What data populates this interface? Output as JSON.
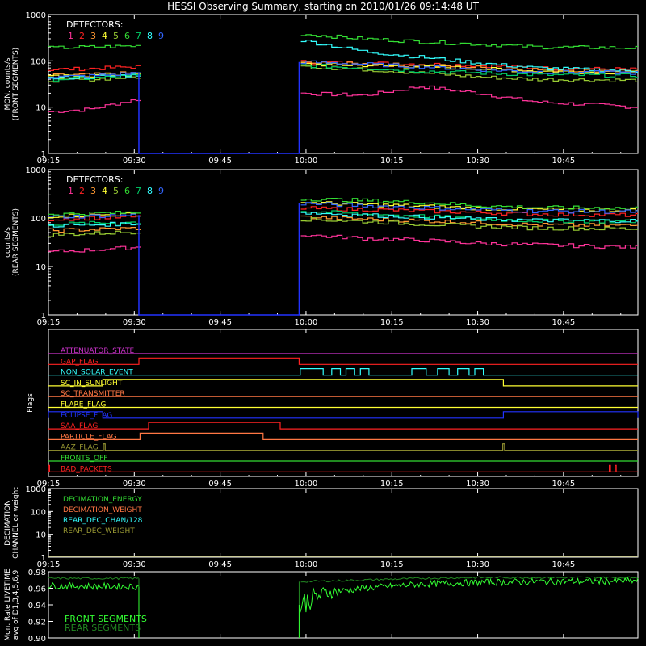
{
  "title": "HESSI Observing Summary, starting on 2010/01/26 09:14:48 UT",
  "detectors_label": "DETECTORS:",
  "detector_numbers": [
    "1",
    "2",
    "3",
    "4",
    "5",
    "6",
    "7",
    "8",
    "9"
  ],
  "colors": {
    "background": "#000000",
    "det": [
      "#ff3399",
      "#ff2222",
      "#ff9933",
      "#ffff33",
      "#99cc33",
      "#33dd33",
      "#00cc66",
      "#33ffff",
      "#3366ff"
    ],
    "blue": "#2233ff"
  },
  "time_axis": {
    "start_min": 555,
    "end_min": 658,
    "ticks": [
      "09:15",
      "09:30",
      "09:45",
      "10:00",
      "10:15",
      "10:30",
      "10:45"
    ],
    "tick_min": [
      555,
      570,
      585,
      600,
      615,
      630,
      645
    ]
  },
  "chart_data": [
    {
      "id": "front",
      "type": "line",
      "ylabel": [
        "MON. counts/s",
        "(FRONT SEGMENTS)"
      ],
      "yscale": "log",
      "ylim": [
        1,
        1000
      ],
      "yticks": [
        "1",
        "10",
        "100",
        "1000"
      ],
      "gap": {
        "start_min": 570.8,
        "end_min": 598.8,
        "value": 1
      },
      "series": [
        {
          "detector": 1,
          "color": "#ff3399",
          "x": [
            555,
            562,
            570.5,
            599,
            610,
            620,
            630,
            640,
            658
          ],
          "y": [
            8,
            9,
            15,
            20,
            18,
            28,
            20,
            13,
            10
          ]
        },
        {
          "detector": 2,
          "color": "#ff2222",
          "x": [
            555,
            562,
            570.5,
            599,
            610,
            620,
            630,
            640,
            658
          ],
          "y": [
            65,
            68,
            75,
            95,
            90,
            85,
            80,
            70,
            65
          ]
        },
        {
          "detector": 3,
          "color": "#ff9933",
          "x": [
            555,
            562,
            570.5,
            599,
            610,
            620,
            630,
            640,
            658
          ],
          "y": [
            48,
            50,
            55,
            90,
            85,
            80,
            72,
            65,
            60
          ]
        },
        {
          "detector": 4,
          "color": "#ffff33",
          "x": [
            555,
            562,
            570.5,
            599,
            610,
            620,
            630,
            640,
            658
          ],
          "y": [
            45,
            48,
            52,
            85,
            80,
            75,
            68,
            60,
            55
          ]
        },
        {
          "detector": 5,
          "color": "#99cc33",
          "x": [
            555,
            562,
            570.5,
            599,
            610,
            620,
            630,
            640,
            658
          ],
          "y": [
            38,
            40,
            45,
            75,
            65,
            55,
            45,
            40,
            38
          ]
        },
        {
          "detector": 6,
          "color": "#33dd33",
          "x": [
            555,
            562,
            570.5,
            599,
            610,
            620,
            630,
            640,
            658
          ],
          "y": [
            190,
            200,
            210,
            380,
            300,
            260,
            230,
            200,
            190
          ]
        },
        {
          "detector": 7,
          "color": "#00cc66",
          "x": [
            555,
            562,
            570.5,
            599,
            610,
            620,
            630,
            640,
            658
          ],
          "y": [
            40,
            42,
            48,
            80,
            70,
            60,
            55,
            50,
            48
          ]
        },
        {
          "detector": 8,
          "color": "#33ffff",
          "x": [
            555,
            562,
            570.5,
            599,
            610,
            620,
            630,
            640,
            658
          ],
          "y": [
            42,
            45,
            50,
            280,
            160,
            120,
            90,
            70,
            60
          ]
        },
        {
          "detector": 9,
          "color": "#3366ff",
          "x": [
            555,
            562,
            570.5,
            599,
            610,
            620,
            630,
            640,
            658
          ],
          "y": [
            45,
            47,
            55,
            95,
            85,
            75,
            65,
            58,
            55
          ]
        }
      ]
    },
    {
      "id": "rear",
      "type": "line",
      "ylabel": [
        "counts/s",
        "(REAR SEGMENTS)"
      ],
      "yscale": "log",
      "ylim": [
        1,
        1000
      ],
      "yticks": [
        "1",
        "10",
        "100",
        "1000"
      ],
      "gap": {
        "start_min": 570.8,
        "end_min": 598.8,
        "value": 1
      },
      "series": [
        {
          "detector": 1,
          "color": "#ff3399",
          "x": [
            555,
            562,
            570.5,
            599,
            610,
            620,
            630,
            640,
            658
          ],
          "y": [
            20,
            22,
            25,
            45,
            38,
            35,
            30,
            28,
            25
          ]
        },
        {
          "detector": 2,
          "color": "#ff2222",
          "x": [
            555,
            562,
            570.5,
            599,
            610,
            620,
            630,
            640,
            658
          ],
          "y": [
            95,
            100,
            105,
            160,
            150,
            140,
            130,
            120,
            115
          ]
        },
        {
          "detector": 3,
          "color": "#ff9933",
          "x": [
            555,
            562,
            570.5,
            599,
            610,
            620,
            630,
            640,
            658
          ],
          "y": [
            55,
            58,
            62,
            105,
            95,
            88,
            80,
            72,
            70
          ]
        },
        {
          "detector": 4,
          "color": "#ffff33",
          "x": [
            555,
            562,
            570.5,
            599,
            610,
            620,
            630,
            640,
            658
          ],
          "y": [
            110,
            115,
            120,
            210,
            190,
            175,
            160,
            150,
            145
          ]
        },
        {
          "detector": 5,
          "color": "#99cc33",
          "x": [
            555,
            562,
            570.5,
            599,
            610,
            620,
            630,
            640,
            658
          ],
          "y": [
            45,
            48,
            52,
            95,
            85,
            75,
            68,
            62,
            60
          ]
        },
        {
          "detector": 6,
          "color": "#33dd33",
          "x": [
            555,
            562,
            570.5,
            599,
            610,
            620,
            630,
            640,
            658
          ],
          "y": [
            120,
            125,
            130,
            250,
            230,
            210,
            180,
            165,
            160
          ]
        },
        {
          "detector": 7,
          "color": "#00cc66",
          "x": [
            555,
            562,
            570.5,
            599,
            610,
            620,
            630,
            640,
            658
          ],
          "y": [
            75,
            78,
            82,
            140,
            120,
            110,
            95,
            88,
            85
          ]
        },
        {
          "detector": 8,
          "color": "#33ffff",
          "x": [
            555,
            562,
            570.5,
            599,
            610,
            620,
            630,
            640,
            658
          ],
          "y": [
            70,
            72,
            78,
            130,
            115,
            105,
            95,
            90,
            88
          ]
        },
        {
          "detector": 9,
          "color": "#3366ff",
          "x": [
            555,
            562,
            570.5,
            599,
            610,
            620,
            630,
            640,
            658
          ],
          "y": [
            105,
            110,
            115,
            200,
            180,
            165,
            150,
            140,
            135
          ]
        }
      ]
    },
    {
      "id": "flags",
      "type": "line",
      "ylabel": "Flags",
      "flags": [
        {
          "name": "ATTENUATOR_STATE",
          "color": "#cc33cc",
          "on": []
        },
        {
          "name": "GAP_FLAG",
          "color": "#ff2222",
          "on": [
            [
              570.8,
              598.8
            ]
          ]
        },
        {
          "name": "NON_SOLAR_EVENT",
          "color": "#33ffff",
          "on": [
            [
              599,
              603
            ],
            [
              604.5,
              606
            ],
            [
              607,
              608.5
            ],
            [
              609.5,
              611
            ],
            [
              618.5,
              621
            ],
            [
              623,
              625
            ],
            [
              626.5,
              628.5
            ],
            [
              629.5,
              631
            ]
          ]
        },
        {
          "name": "SC_IN_SUNLIGHT",
          "color": "#ffff33",
          "on": [
            [
              564.5,
              634.5
            ]
          ]
        },
        {
          "name": "SC_TRANSMITTER",
          "color": "#ff7744",
          "on": []
        },
        {
          "name": "FLARE_FLAG",
          "color": "#ffff33",
          "on": []
        },
        {
          "name": "ECLIPSE_FLAG",
          "color": "#2233ff",
          "on": [
            [
              555,
              564.5
            ],
            [
              634.5,
              658
            ]
          ]
        },
        {
          "name": "SAA_FLAG",
          "color": "#ff2222",
          "on": [
            [
              572.5,
              595.5
            ]
          ]
        },
        {
          "name": "PARTICLE_FLAG",
          "color": "#ff7744",
          "on": [
            [
              571,
              592.5
            ]
          ]
        },
        {
          "name": "AAZ_FLAG",
          "color": "#999933",
          "on": [
            [
              564.6,
              564.9
            ],
            [
              634.4,
              634.7
            ]
          ]
        },
        {
          "name": "FRONTS_OFF",
          "color": "#33dd33",
          "on": []
        },
        {
          "name": "BAD_PACKETS",
          "color": "#ff2222",
          "on": [
            [
              555,
              555.2
            ],
            [
              653,
              653.2
            ],
            [
              654,
              654.2
            ]
          ]
        }
      ]
    },
    {
      "id": "decimation",
      "type": "line",
      "ylabel": [
        "DECIMATION",
        "CHANNEL or weight"
      ],
      "yscale": "log",
      "ylim": [
        1,
        1000
      ],
      "yticks": [
        "1",
        "10",
        "100",
        "1000"
      ],
      "series": [
        {
          "name": "DECIMATION_ENERGY",
          "color": "#33dd33",
          "x": [
            555,
            658
          ],
          "y": [
            1,
            1
          ]
        },
        {
          "name": "DECIMATION_WEIGHT",
          "color": "#ff7744",
          "x": [
            555,
            658
          ],
          "y": [
            1,
            1
          ]
        },
        {
          "name": "REAR_DEC_CHAN/128",
          "color": "#33ffff",
          "x": [
            555,
            658
          ],
          "y": [
            1,
            1
          ]
        },
        {
          "name": "REAR_DEC_WEIGHT",
          "color": "#999933",
          "x": [
            555,
            658
          ],
          "y": [
            1,
            1
          ]
        }
      ]
    },
    {
      "id": "livetime",
      "type": "line",
      "ylabel": [
        "Mon. Rate LIVETIME",
        "avg of D1,3,4,5,6,9"
      ],
      "ylim": [
        0.9,
        0.98
      ],
      "yticks": [
        "0.90",
        "0.92",
        "0.94",
        "0.96",
        "0.98"
      ],
      "gap": {
        "start_min": 570.8,
        "end_min": 598.8
      },
      "series": [
        {
          "name": "FRONT SEGMENTS",
          "color": "#33ff33",
          "x": [
            555,
            570.5,
            599,
            601,
            604,
            610,
            620,
            630,
            640,
            658
          ],
          "y": [
            0.963,
            0.962,
            0.94,
            0.948,
            0.955,
            0.96,
            0.965,
            0.967,
            0.968,
            0.969
          ]
        },
        {
          "name": "REAR SEGMENTS",
          "color": "#228822",
          "x": [
            555,
            570.5,
            599,
            610,
            620,
            630,
            640,
            658
          ],
          "y": [
            0.972,
            0.972,
            0.968,
            0.97,
            0.972,
            0.973,
            0.973,
            0.973
          ]
        }
      ]
    }
  ]
}
